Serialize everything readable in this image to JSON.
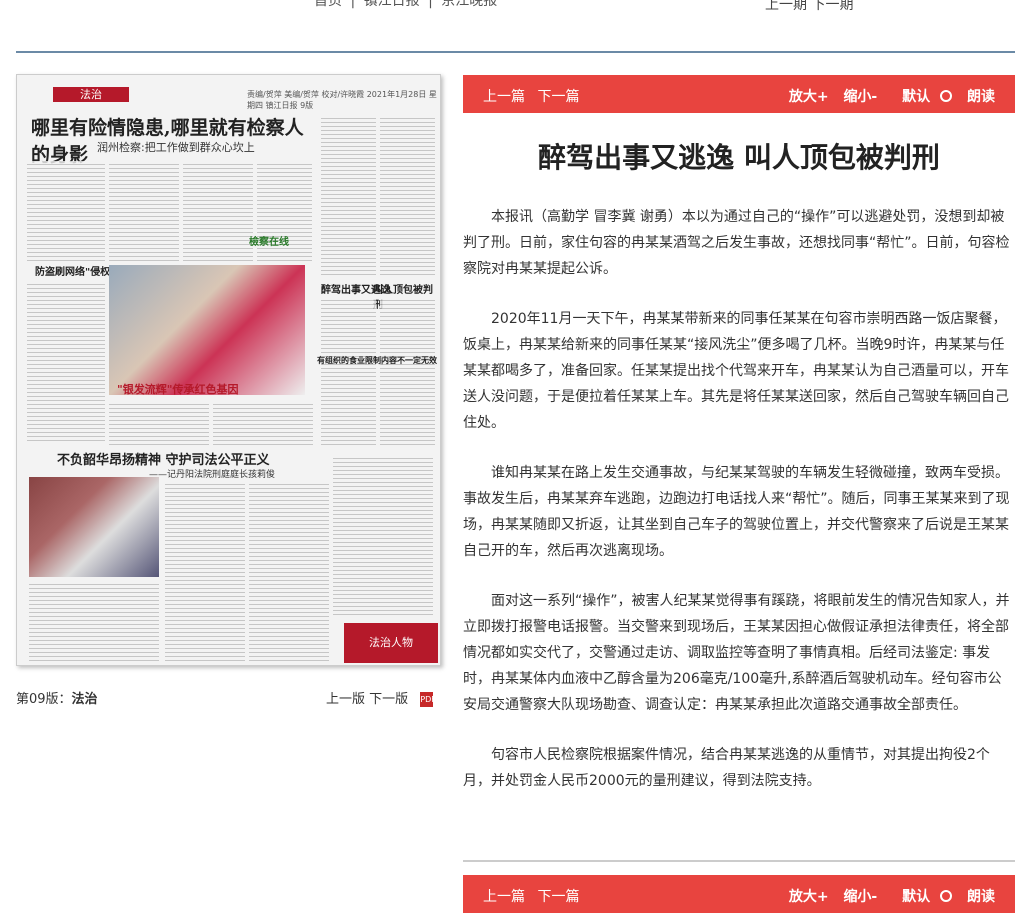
{
  "top_nav": {
    "links": [
      "首页",
      "镇江日报",
      "京江晚报"
    ],
    "sep": "|",
    "pager": "上一期  下一期"
  },
  "newspaper_thumb": {
    "section_tag": "法治",
    "masthead_text": "责编/贺萍 美编/贺萍 校对/许晓霞    2021年1月28日 星期四    镇江日报 9版",
    "headline": "哪里有险情隐患,哪里就有检察人的身影",
    "subhead": "润州检察:把工作做到群众心坎上",
    "photo_caption": "\"银发流辉\"传承红色基因",
    "headline2": "不负韶华昂扬精神  守护司法公平正义",
    "subhead2": "——记丹阳法院刑庭庭长孩莉俊",
    "side_heads": [
      "醉驾出事又逃逸",
      "叫人顶包被判刑",
      "有组织的食业限制内容不一定无效",
      "防盗刷网络\"侵权\"",
      "檢察在线"
    ],
    "corner_logo": "法治人物"
  },
  "page_caption": {
    "prefix": "第09版：",
    "name": "法治"
  },
  "page_nav": {
    "prev": "上一版",
    "next": "下一版",
    "pdf": "PDF"
  },
  "toolbar": {
    "prev": "上一篇",
    "next": "下一篇",
    "zoom_in": "放大+",
    "zoom_out": "缩小-",
    "default": "默认",
    "read": "朗读"
  },
  "article": {
    "title": "醉驾出事又逃逸 叫人顶包被判刑",
    "paragraphs": [
      "本报讯（高勤学 冒李冀 谢勇）本以为通过自己的“操作”可以逃避处罚，没想到却被判了刑。日前，家住句容的冉某某酒驾之后发生事故，还想找同事“帮忙”。日前，句容检察院对冉某某提起公诉。",
      "2020年11月一天下午，冉某某带新来的同事任某某在句容市崇明西路一饭店聚餐，饭桌上，冉某某给新来的同事任某某“接风洗尘”便多喝了几杯。当晚9时许，冉某某与任某某都喝多了，准备回家。任某某提出找个代驾来开车，冉某某认为自己酒量可以，开车送人没问题，于是便拉着任某某上车。其先是将任某某送回家，然后自己驾驶车辆回自己住处。",
      "谁知冉某某在路上发生交通事故，与纪某某驾驶的车辆发生轻微碰撞，致两车受损。事故发生后，冉某某弃车逃跑，边跑边打电话找人来“帮忙”。随后，同事王某某来到了现场，冉某某随即又折返，让其坐到自己车子的驾驶位置上，并交代警察来了后说是王某某自己开的车，然后再次逃离现场。",
      "面对这一系列“操作”，被害人纪某某觉得事有蹊跷，将眼前发生的情况告知家人，并立即拨打报警电话报警。当交警来到现场后，王某某因担心做假证承担法律责任，将全部情况都如实交代了，交警通过走访、调取监控等查明了事情真相。后经司法鉴定: 事发时，冉某某体内血液中乙醇含量为206毫克/100毫升,系醉酒后驾驶机动车。经句容市公安局交通警察大队现场勘查、调查认定：冉某某承担此次道路交通事故全部责任。",
      "句容市人民检察院根据案件情况，结合冉某某逃逸的从重情节，对其提出拘役2个月，并处罚金人民币2000元的量刑建议，得到法院支持。"
    ]
  },
  "colors": {
    "toolbar_bg": "#e8443f",
    "section_tag": "#b5192a",
    "rule": "#6b8aa6"
  }
}
